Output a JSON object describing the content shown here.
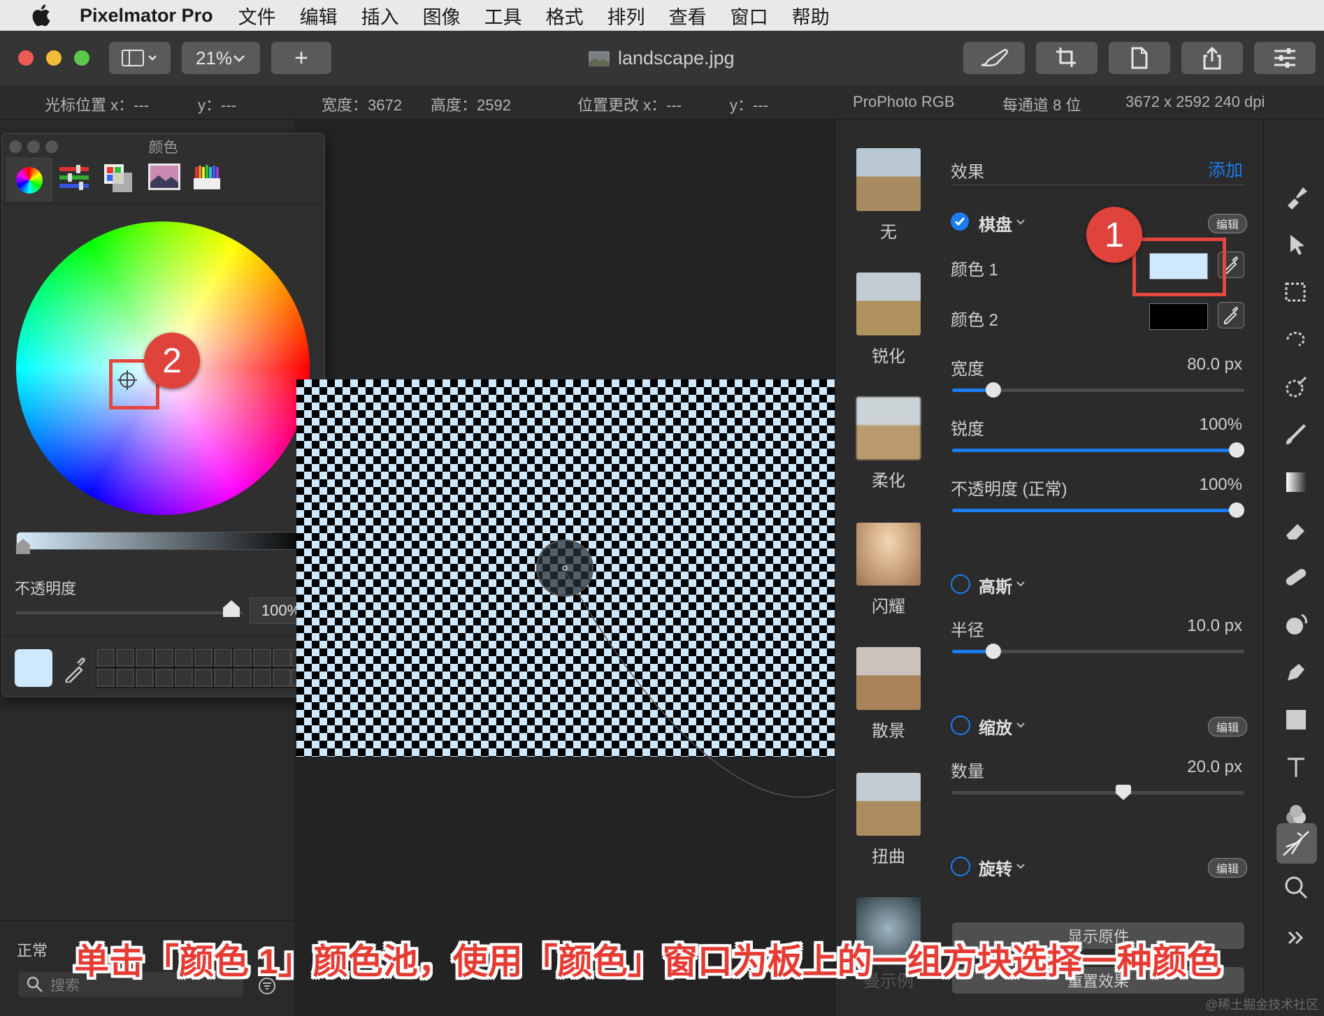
{
  "menu": {
    "app_name": "Pixelmator Pro",
    "items": [
      "文件",
      "编辑",
      "插入",
      "图像",
      "工具",
      "格式",
      "排列",
      "查看",
      "窗口",
      "帮助"
    ]
  },
  "toolbar": {
    "zoom": "21%",
    "add_label": "+",
    "document_title": "landscape.jpg"
  },
  "infobar": {
    "cursor_x": "光标位置 x：---",
    "cursor_y": "y：---",
    "width": "宽度：3672",
    "height": "高度：2592",
    "pos_change_x": "位置更改 x：---",
    "pos_change_y": "y：---",
    "color_profile": "ProPhoto RGB",
    "bit_depth": "每通道 8 位",
    "dimensions": "3672 x 2592 240 dpi"
  },
  "color_window": {
    "title": "颜色",
    "opacity_label": "不透明度",
    "opacity_value": "100%",
    "swatch_color": "#cfe8fb"
  },
  "layers_footer": {
    "blend_mode": "正常",
    "search_placeholder": "搜索"
  },
  "effects_panel": {
    "header_label": "效果",
    "add_label": "添加",
    "checkerboard": {
      "name": "棋盘",
      "edit_label": "编辑",
      "color1_label": "颜色 1",
      "color1_value": "#cfe8fb",
      "color2_label": "颜色 2",
      "color2_value": "#000000",
      "width_label": "宽度",
      "width_value": "80.0 px",
      "width_fraction": 0.12,
      "sharpness_label": "锐度",
      "sharpness_value": "100%",
      "sharpness_fraction": 1.0,
      "opacity_label": "不透明度 (正常)",
      "opacity_value": "100%",
      "opacity_fraction": 1.0
    },
    "gaussian": {
      "name": "高斯",
      "radius_label": "半径",
      "radius_value": "10.0 px",
      "radius_fraction": 0.12
    },
    "zoom": {
      "name": "缩放",
      "edit_label": "编辑",
      "amount_label": "数量",
      "amount_value": "20.0 px",
      "amount_fraction": 0.59
    },
    "rotate": {
      "name": "旋转",
      "edit_label": "编辑"
    },
    "show_original_label": "显示原件",
    "reset_label": "重置效果"
  },
  "presets": [
    "无",
    "锐化",
    "柔化",
    "闪耀",
    "散景",
    "扭曲",
    "曼示例"
  ],
  "annotations": {
    "badge1": "1",
    "badge2": "2",
    "caption": "单击「颜色 1」颜色池，使用「颜色」窗口为板上的一组方块选择一种颜色",
    "watermark": "@稀土掘金技术社区"
  },
  "colors": {
    "accent": "#1a7cf0",
    "annotation_red": "#e5473f",
    "checker_light": "#cfe8fb"
  }
}
